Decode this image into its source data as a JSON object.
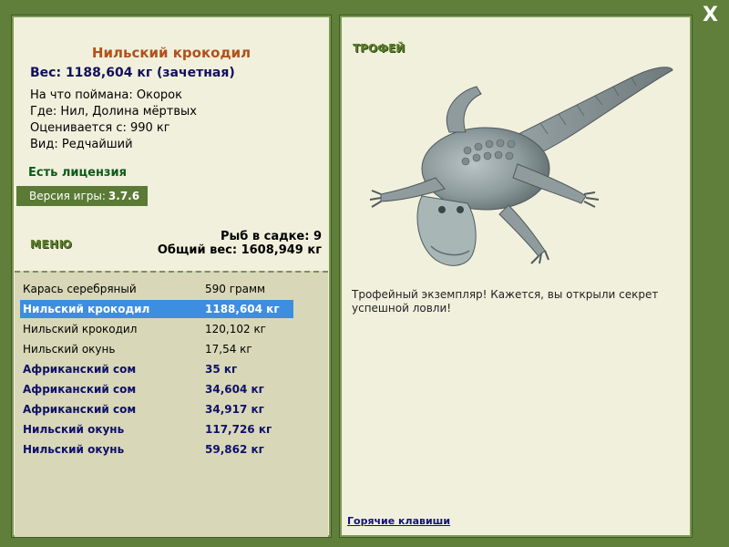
{
  "window": {
    "close_label": "X"
  },
  "fish": {
    "title": "Нильский крокодил",
    "weight_line": "Вес: 1188,604 кг (зачетная)",
    "bait": "На что поймана: Окорок",
    "location": "Где: Нил, Долина мёртвых",
    "valued_from": "Оценивается с: 990 кг",
    "kind": "Вид: Редчайший"
  },
  "license": "Есть лицензия",
  "version": {
    "label": "Версия игры:",
    "value": "3.7.6"
  },
  "menu_label": "МЕНЮ",
  "keepnet": {
    "count": "Рыб в садке: 9",
    "total": "Общий вес: 1608,949 кг"
  },
  "catch_list": [
    {
      "name": "Карась серебряный",
      "weight": "590 грамм",
      "style": "normal"
    },
    {
      "name": "Нильский крокодил",
      "weight": "1188,604 кг",
      "style": "selected"
    },
    {
      "name": "Нильский крокодил",
      "weight": "120,102 кг",
      "style": "normal"
    },
    {
      "name": "Нильский окунь",
      "weight": "17,54 кг",
      "style": "normal"
    },
    {
      "name": "Африканский сом",
      "weight": "35 кг",
      "style": "bold"
    },
    {
      "name": "Африканский сом",
      "weight": "34,604 кг",
      "style": "bold"
    },
    {
      "name": "Африканский сом",
      "weight": "34,917 кг",
      "style": "bold"
    },
    {
      "name": "Нильский окунь",
      "weight": "117,726 кг",
      "style": "bold"
    },
    {
      "name": "Нильский окунь",
      "weight": "59,862 кг",
      "style": "bold"
    }
  ],
  "trophy": {
    "label": "ТРОФЕЙ",
    "image": "nile-crocodile-photo",
    "text": "Трофейный экземпляр! Кажется, вы открыли секрет успешной ловли!"
  },
  "hotkeys_label": "Горячие клавиши",
  "colors": {
    "background": "#5f7f3a",
    "panel": "#f1f0dd",
    "list_bg": "#d8d8b8",
    "selected": "#3d8ee0",
    "title": "#b0521a"
  }
}
